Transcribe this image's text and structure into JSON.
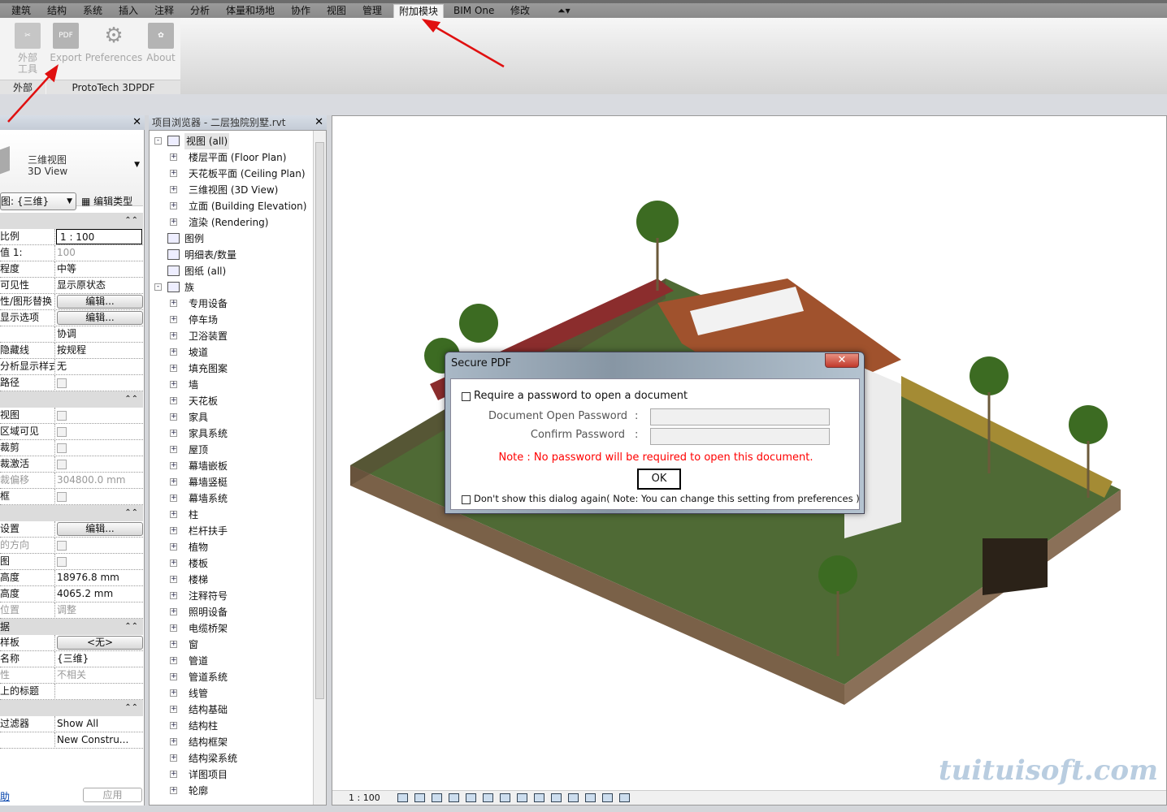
{
  "ribbon_tabs": [
    "建筑",
    "结构",
    "系统",
    "插入",
    "注释",
    "分析",
    "体量和场地",
    "协作",
    "视图",
    "管理",
    "附加模块",
    "BIM One",
    "修改"
  ],
  "active_tab": "附加模块",
  "ribbon": {
    "external_tools": "外部\n工具",
    "external_group": "外部",
    "export": "Export",
    "preferences": "Preferences",
    "about": "About",
    "pdf_icon_text": "PDF",
    "group": "ProtoTech 3DPDF"
  },
  "properties": {
    "type_name": "三维视图",
    "type_sub": "3D View",
    "view_selector": "图: {三维}",
    "edit_type": "编辑类型",
    "rows": [
      {
        "k": "比例",
        "v": "1 : 100",
        "kind": "input"
      },
      {
        "k": "值 1:",
        "v": "100",
        "kind": "gray"
      },
      {
        "k": "程度",
        "v": "中等"
      },
      {
        "k": "可见性",
        "v": "显示原状态"
      },
      {
        "k": "性/图形替换",
        "v": "编辑...",
        "kind": "button"
      },
      {
        "k": "显示选项",
        "v": "编辑...",
        "kind": "button"
      },
      {
        "k": "",
        "v": "协调"
      },
      {
        "k": "隐藏线",
        "v": "按规程"
      },
      {
        "k": "分析显示样式",
        "v": "无"
      },
      {
        "k": "路径",
        "kind": "checkbox"
      },
      {
        "section": ""
      },
      {
        "k": "视图",
        "kind": "checkbox"
      },
      {
        "k": "区域可见",
        "kind": "checkbox"
      },
      {
        "k": "裁剪",
        "kind": "checkbox"
      },
      {
        "k": "裁激活",
        "kind": "checkbox"
      },
      {
        "k": "裁偏移",
        "v": "304800.0 mm",
        "kind": "gray",
        "kgray": true
      },
      {
        "k": "框",
        "kind": "checkbox"
      },
      {
        "section": ""
      },
      {
        "k": "设置",
        "v": "编辑...",
        "kind": "button"
      },
      {
        "k": "的方向",
        "kind": "checkbox",
        "kgray": true
      },
      {
        "k": "图",
        "kind": "checkbox"
      },
      {
        "k": "高度",
        "v": "18976.8 mm"
      },
      {
        "k": "高度",
        "v": "4065.2 mm"
      },
      {
        "k": "位置",
        "v": "调整",
        "kind": "gray",
        "kgray": true
      },
      {
        "section": "据"
      },
      {
        "k": "样板",
        "v": "<无>",
        "kind": "button"
      },
      {
        "k": "名称",
        "v": "{三维}"
      },
      {
        "k": "性",
        "v": "不相关",
        "kind": "gray",
        "kgray": true
      },
      {
        "k": "上的标题",
        "v": ""
      },
      {
        "section": ""
      },
      {
        "k": "过滤器",
        "v": "Show All"
      },
      {
        "k": "",
        "v": "New Constru..."
      }
    ],
    "help_link": "助",
    "apply": "应用"
  },
  "browser": {
    "title": "项目浏览器 - 二层独院别墅.rvt",
    "items": [
      {
        "t": "视图 (all)",
        "lvl": 0,
        "pm": "-",
        "icon": true
      },
      {
        "t": "楼层平面 (Floor Plan)",
        "lvl": 1,
        "pm": "+"
      },
      {
        "t": "天花板平面 (Ceiling Plan)",
        "lvl": 1,
        "pm": "+"
      },
      {
        "t": "三维视图 (3D View)",
        "lvl": 1,
        "pm": "+"
      },
      {
        "t": "立面 (Building Elevation)",
        "lvl": 1,
        "pm": "+"
      },
      {
        "t": "渲染 (Rendering)",
        "lvl": 1,
        "pm": "+"
      },
      {
        "t": "图例",
        "lvl": 0,
        "icon": true
      },
      {
        "t": "明细表/数量",
        "lvl": 0,
        "icon": true
      },
      {
        "t": "图纸 (all)",
        "lvl": 0,
        "icon": true
      },
      {
        "t": "族",
        "lvl": 0,
        "pm": "-",
        "icon": true
      },
      {
        "t": "专用设备",
        "lvl": 1,
        "pm": "+"
      },
      {
        "t": "停车场",
        "lvl": 1,
        "pm": "+"
      },
      {
        "t": "卫浴装置",
        "lvl": 1,
        "pm": "+"
      },
      {
        "t": "坡道",
        "lvl": 1,
        "pm": "+"
      },
      {
        "t": "填充图案",
        "lvl": 1,
        "pm": "+"
      },
      {
        "t": "墙",
        "lvl": 1,
        "pm": "+"
      },
      {
        "t": "天花板",
        "lvl": 1,
        "pm": "+"
      },
      {
        "t": "家具",
        "lvl": 1,
        "pm": "+"
      },
      {
        "t": "家具系统",
        "lvl": 1,
        "pm": "+"
      },
      {
        "t": "屋顶",
        "lvl": 1,
        "pm": "+"
      },
      {
        "t": "幕墙嵌板",
        "lvl": 1,
        "pm": "+"
      },
      {
        "t": "幕墙竖梃",
        "lvl": 1,
        "pm": "+"
      },
      {
        "t": "幕墙系统",
        "lvl": 1,
        "pm": "+"
      },
      {
        "t": "柱",
        "lvl": 1,
        "pm": "+"
      },
      {
        "t": "栏杆扶手",
        "lvl": 1,
        "pm": "+"
      },
      {
        "t": "植物",
        "lvl": 1,
        "pm": "+"
      },
      {
        "t": "楼板",
        "lvl": 1,
        "pm": "+"
      },
      {
        "t": "楼梯",
        "lvl": 1,
        "pm": "+"
      },
      {
        "t": "注释符号",
        "lvl": 1,
        "pm": "+"
      },
      {
        "t": "照明设备",
        "lvl": 1,
        "pm": "+"
      },
      {
        "t": "电缆桥架",
        "lvl": 1,
        "pm": "+"
      },
      {
        "t": "窗",
        "lvl": 1,
        "pm": "+"
      },
      {
        "t": "管道",
        "lvl": 1,
        "pm": "+"
      },
      {
        "t": "管道系统",
        "lvl": 1,
        "pm": "+"
      },
      {
        "t": "线管",
        "lvl": 1,
        "pm": "+"
      },
      {
        "t": "结构基础",
        "lvl": 1,
        "pm": "+"
      },
      {
        "t": "结构柱",
        "lvl": 1,
        "pm": "+"
      },
      {
        "t": "结构框架",
        "lvl": 1,
        "pm": "+"
      },
      {
        "t": "结构梁系统",
        "lvl": 1,
        "pm": "+"
      },
      {
        "t": "详图项目",
        "lvl": 1,
        "pm": "+"
      },
      {
        "t": "轮廓",
        "lvl": 1,
        "pm": "+"
      }
    ]
  },
  "view": {
    "scale": "1 : 100",
    "watermark": "tuituisoft.com"
  },
  "dialog": {
    "title": "Secure PDF",
    "close": "✕",
    "require_pw": "Require a password to open a document",
    "open_pw_label": "Document Open Password",
    "confirm_pw_label": "Confirm Password",
    "colon": ":",
    "open_pw_value": "",
    "confirm_pw_value": "",
    "note": "Note : No password will be required to open this document.",
    "ok": "OK",
    "dont_show": "Don't show this dialog again( Note: You can change this setting from preferences )",
    "note_color": "#ff0000"
  }
}
